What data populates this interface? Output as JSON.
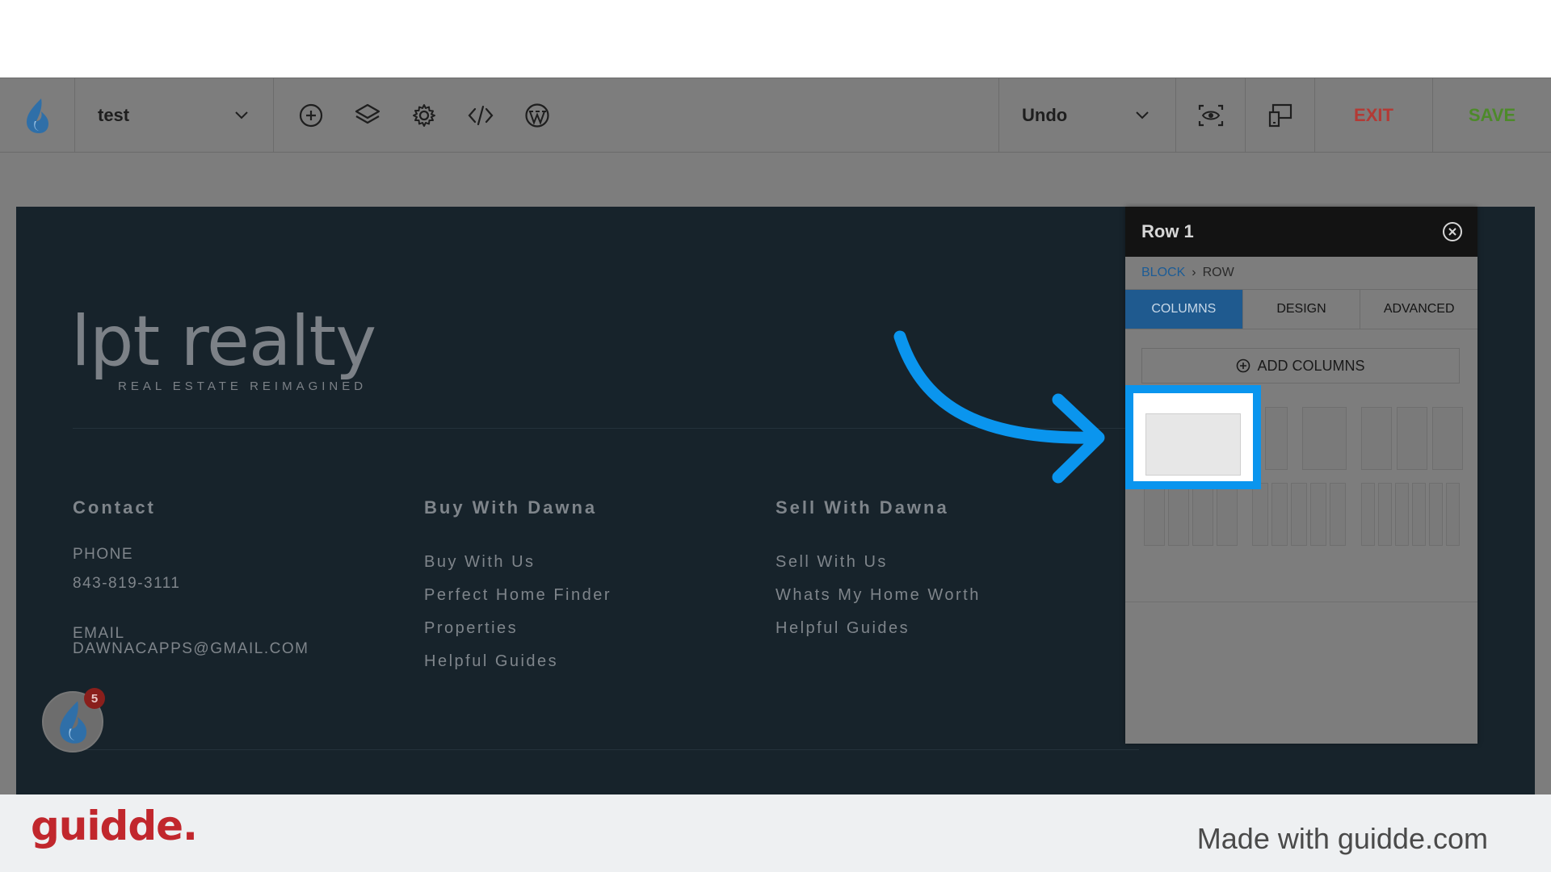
{
  "toolbar": {
    "page_name": "test",
    "undo_label": "Undo",
    "exit_label": "EXIT",
    "save_label": "SAVE",
    "icons": [
      "flame-logo-icon",
      "chevron-down-icon",
      "add-circle-icon",
      "layers-icon",
      "gear-icon",
      "code-icon",
      "wordpress-icon",
      "preview-eye-icon",
      "responsive-devices-icon"
    ],
    "colors": {
      "exit": "#b33a35",
      "save": "#4d8a2a"
    }
  },
  "footer_site": {
    "brand_name": "lpt realty",
    "brand_tagline": "REAL ESTATE REIMAGINED",
    "contact": {
      "title": "Contact",
      "phone_label": "PHONE",
      "phone": "843-819-3111",
      "email_label": "EMAIL",
      "email": "DAWNACAPPS@GMAIL.COM"
    },
    "buy": {
      "title": "Buy With Dawna",
      "links": [
        "Buy With Us",
        "Perfect Home Finder",
        "Properties",
        "Helpful Guides"
      ]
    },
    "sell": {
      "title": "Sell With Dawna",
      "links": [
        "Sell With Us",
        "Whats My Home Worth",
        "Helpful Guides"
      ]
    },
    "chat_badge_count": "5"
  },
  "panel": {
    "title": "Row 1",
    "breadcrumb": {
      "block": "BLOCK",
      "separator": "›",
      "row": "ROW"
    },
    "tabs": [
      "COLUMNS",
      "DESIGN",
      "ADVANCED"
    ],
    "active_tab": "COLUMNS",
    "add_columns_label": "ADD COLUMNS"
  },
  "watermark": {
    "logo": "guidde.",
    "made_with": "Made with guidde.com"
  },
  "colors": {
    "accent_blue": "#0a95ee",
    "active_tab": "#1f5a8f",
    "site_background": "#17232b"
  }
}
